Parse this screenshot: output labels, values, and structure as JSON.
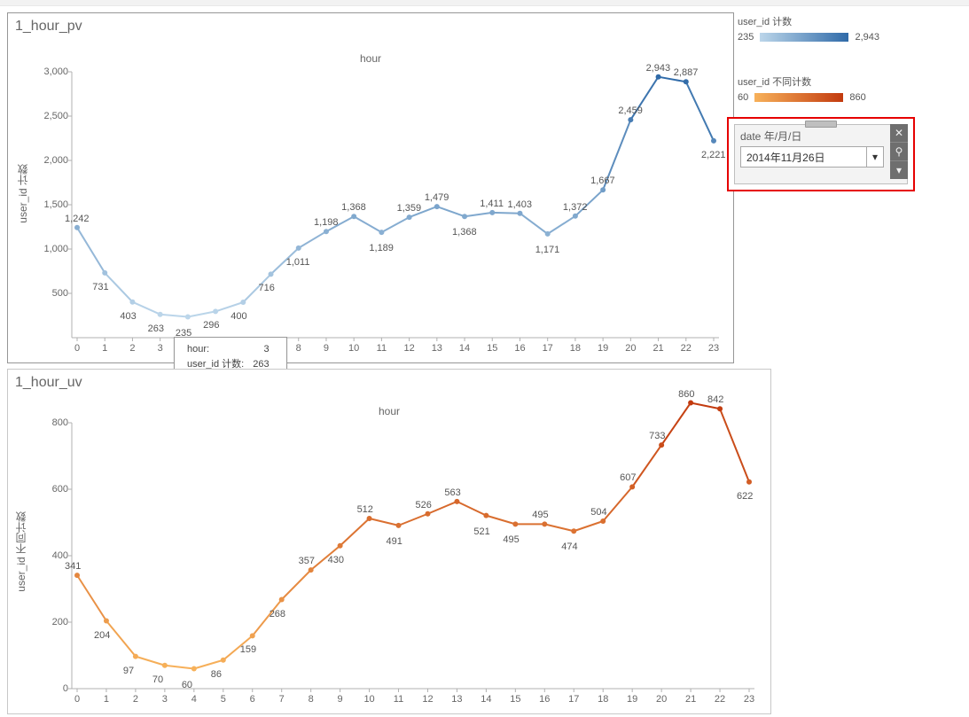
{
  "chart_data": [
    {
      "type": "line",
      "id": "pv",
      "title": "1_hour_pv",
      "xlabel": "hour",
      "ylabel": "user_id 计数",
      "x": [
        0,
        1,
        2,
        3,
        4,
        5,
        6,
        7,
        8,
        9,
        10,
        11,
        12,
        13,
        14,
        15,
        16,
        17,
        18,
        19,
        20,
        21,
        22,
        23
      ],
      "values": [
        1242,
        731,
        403,
        263,
        235,
        296,
        400,
        716,
        1011,
        1198,
        1368,
        1189,
        1359,
        1479,
        1368,
        1411,
        1403,
        1171,
        1372,
        1667,
        2459,
        2943,
        2887,
        2221
      ],
      "ylim": [
        0,
        3000
      ],
      "yticks": [
        500,
        1000,
        1500,
        2000,
        2500,
        3000
      ],
      "color_min": "#bcd6ea",
      "color_max": "#2f6aa8",
      "value_min": 235,
      "value_max": 2943,
      "label_dy": [
        -12,
        12,
        12,
        12,
        14,
        12,
        12,
        12,
        12,
        -12,
        -12,
        14,
        -12,
        -12,
        14,
        -12,
        -12,
        14,
        -12,
        -12,
        -12,
        -12,
        -12,
        12
      ]
    },
    {
      "type": "line",
      "id": "uv",
      "title": "1_hour_uv",
      "xlabel": "hour",
      "ylabel": "user_id 不同计数",
      "x": [
        0,
        1,
        2,
        3,
        4,
        5,
        6,
        7,
        8,
        9,
        10,
        11,
        12,
        13,
        14,
        15,
        16,
        17,
        18,
        19,
        20,
        21,
        22,
        23
      ],
      "values": [
        341,
        204,
        97,
        70,
        60,
        86,
        159,
        268,
        357,
        430,
        512,
        491,
        526,
        563,
        521,
        495,
        495,
        474,
        504,
        607,
        733,
        860,
        842,
        622
      ],
      "ylim": [
        0,
        800
      ],
      "yticks": [
        0,
        200,
        400,
        600,
        800
      ],
      "color_min": "#f7b15a",
      "color_max": "#c23a0e",
      "value_min": 60,
      "value_max": 860,
      "label_dy": [
        -12,
        12,
        12,
        12,
        14,
        12,
        12,
        12,
        -12,
        12,
        -12,
        14,
        -12,
        -12,
        14,
        14,
        -12,
        14,
        -12,
        -12,
        -12,
        -12,
        -12,
        12
      ]
    }
  ],
  "legend": {
    "blue_title": "user_id 计数",
    "blue_min": "235",
    "blue_max": "2,943",
    "orange_title": "user_id 不同计数",
    "orange_min": "60",
    "orange_max": "860"
  },
  "filter": {
    "title": "date 年/月/日",
    "value": "2014年11月26日"
  },
  "tooltip": {
    "hour_label": "hour:",
    "hour_value": "3",
    "metric_label": "user_id 计数:",
    "metric_value": "263"
  }
}
